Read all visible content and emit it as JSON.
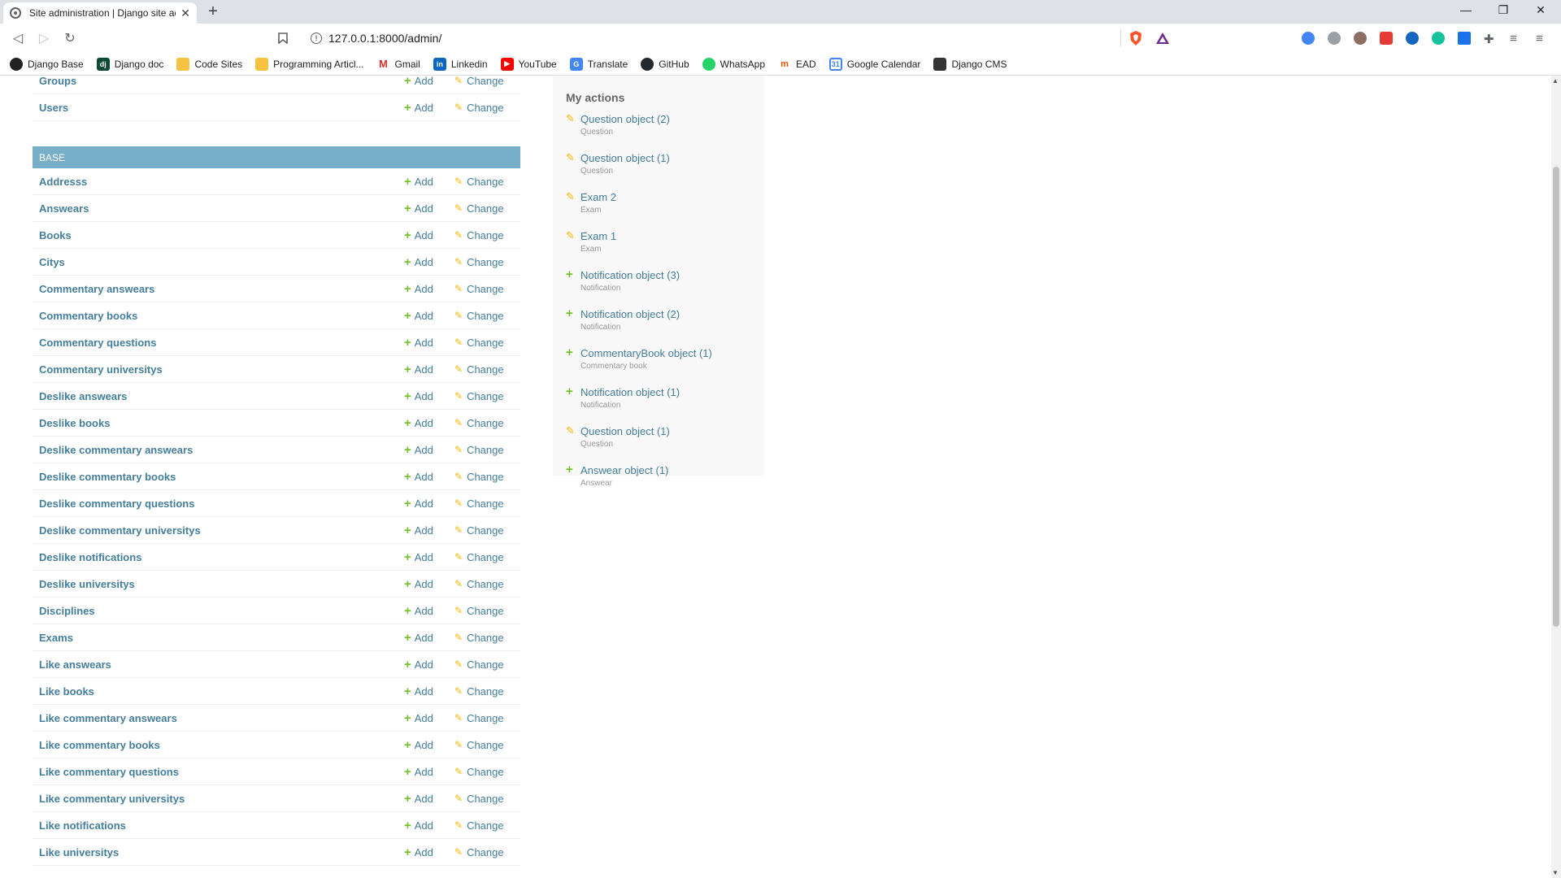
{
  "browser": {
    "tab_title": "Site administration | Django site ad",
    "url": "127.0.0.1:8000/admin/",
    "bookmarks": [
      "Django Base",
      "Django doc",
      "Code Sites",
      "Programming Articl...",
      "Gmail",
      "Linkedin",
      "YouTube",
      "Translate",
      "GitHub",
      "WhatsApp",
      "EAD",
      "Google Calendar",
      "Django CMS"
    ]
  },
  "top_rows": [
    {
      "name": "Groups",
      "add": "Add",
      "change": "Change"
    },
    {
      "name": "Users",
      "add": "Add",
      "change": "Change"
    }
  ],
  "base": {
    "caption": "BASE",
    "rows": [
      {
        "name": "Addresss"
      },
      {
        "name": "Answears"
      },
      {
        "name": "Books"
      },
      {
        "name": "Citys"
      },
      {
        "name": "Commentary answears"
      },
      {
        "name": "Commentary books"
      },
      {
        "name": "Commentary questions"
      },
      {
        "name": "Commentary universitys"
      },
      {
        "name": "Deslike answears"
      },
      {
        "name": "Deslike books"
      },
      {
        "name": "Deslike commentary answears"
      },
      {
        "name": "Deslike commentary books"
      },
      {
        "name": "Deslike commentary questions"
      },
      {
        "name": "Deslike commentary universitys"
      },
      {
        "name": "Deslike notifications"
      },
      {
        "name": "Deslike universitys"
      },
      {
        "name": "Disciplines"
      },
      {
        "name": "Exams"
      },
      {
        "name": "Like answears"
      },
      {
        "name": "Like books"
      },
      {
        "name": "Like commentary answears"
      },
      {
        "name": "Like commentary books"
      },
      {
        "name": "Like commentary questions"
      },
      {
        "name": "Like commentary universitys"
      },
      {
        "name": "Like notifications"
      },
      {
        "name": "Like universitys"
      }
    ],
    "add_label": "Add",
    "change_label": "Change"
  },
  "sidebar": {
    "title": "My actions",
    "actions": [
      {
        "kind": "change",
        "label": "Question object (2)",
        "type": "Question"
      },
      {
        "kind": "change",
        "label": "Question object (1)",
        "type": "Question"
      },
      {
        "kind": "change",
        "label": "Exam 2",
        "type": "Exam"
      },
      {
        "kind": "change",
        "label": "Exam 1",
        "type": "Exam"
      },
      {
        "kind": "add",
        "label": "Notification object (3)",
        "type": "Notification"
      },
      {
        "kind": "add",
        "label": "Notification object (2)",
        "type": "Notification"
      },
      {
        "kind": "add",
        "label": "CommentaryBook object (1)",
        "type": "Commentary book"
      },
      {
        "kind": "add",
        "label": "Notification object (1)",
        "type": "Notification"
      },
      {
        "kind": "change",
        "label": "Question object (1)",
        "type": "Question"
      },
      {
        "kind": "add",
        "label": "Answear object (1)",
        "type": "Answear"
      }
    ]
  },
  "colors": {
    "link": "#447e9b",
    "caption_bg": "#79aec8",
    "add_icon": "#70bf2b",
    "change_icon": "#efb80b"
  }
}
